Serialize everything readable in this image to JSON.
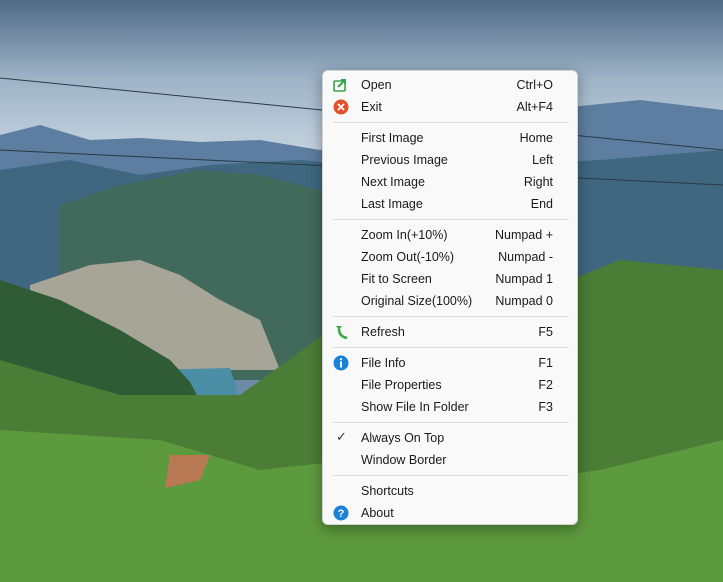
{
  "menu": {
    "open": {
      "label": "Open",
      "shortcut": "Ctrl+O",
      "icon": "open-arrow-icon"
    },
    "exit": {
      "label": "Exit",
      "shortcut": "Alt+F4",
      "icon": "close-circle-icon"
    },
    "first_image": {
      "label": "First Image",
      "shortcut": "Home"
    },
    "previous_image": {
      "label": "Previous Image",
      "shortcut": "Left"
    },
    "next_image": {
      "label": "Next Image",
      "shortcut": "Right"
    },
    "last_image": {
      "label": "Last Image",
      "shortcut": "End"
    },
    "zoom_in": {
      "label": "Zoom In(+10%)",
      "shortcut": "Numpad +"
    },
    "zoom_out": {
      "label": "Zoom Out(-10%)",
      "shortcut": "Numpad -"
    },
    "fit_to_screen": {
      "label": "Fit to Screen",
      "shortcut": "Numpad 1"
    },
    "original_size": {
      "label": "Original Size(100%)",
      "shortcut": "Numpad 0"
    },
    "refresh": {
      "label": "Refresh",
      "shortcut": "F5",
      "icon": "refresh-arrow-icon"
    },
    "file_info": {
      "label": "File Info",
      "shortcut": "F1",
      "icon": "info-icon"
    },
    "file_properties": {
      "label": "File Properties",
      "shortcut": "F2"
    },
    "show_in_folder": {
      "label": "Show File In Folder",
      "shortcut": "F3"
    },
    "always_on_top": {
      "label": "Always On Top",
      "checked": true
    },
    "window_border": {
      "label": "Window Border"
    },
    "shortcuts": {
      "label": "Shortcuts"
    },
    "about": {
      "label": "About",
      "icon": "help-icon"
    }
  },
  "colors": {
    "menu_bg": "#f9f9f9",
    "open_icon": "#3aa64a",
    "exit_icon": "#e2502c",
    "refresh_icon": "#39a845",
    "info_icon": "#1a82d8",
    "about_icon": "#1a82d8"
  }
}
